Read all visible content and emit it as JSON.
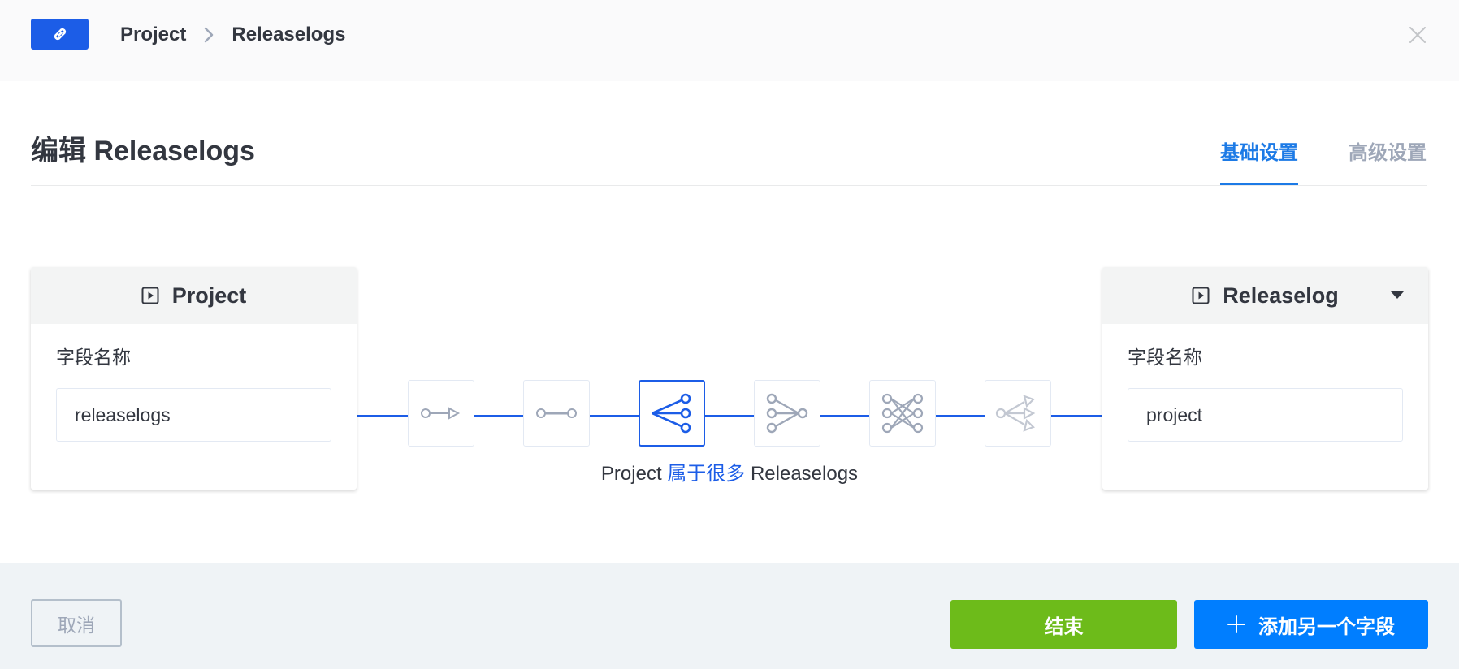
{
  "header": {
    "badge_icon": "link-icon",
    "breadcrumb": [
      "Project",
      "Releaselogs"
    ],
    "close_icon": "close-icon"
  },
  "page": {
    "title": "编辑 Releaselogs",
    "tabs": [
      {
        "label": "基础设置",
        "active": true
      },
      {
        "label": "高级设置",
        "active": false
      }
    ]
  },
  "left_model": {
    "name": "Project",
    "icon": "play-square-icon",
    "field_label": "字段名称",
    "field_value": "releaselogs"
  },
  "right_model": {
    "name": "Releaselog",
    "icon": "play-square-icon",
    "dropdown_icon": "caret-down-icon",
    "field_label": "字段名称",
    "field_value": "project"
  },
  "relation": {
    "types": [
      "one-way",
      "one-to-one",
      "one-to-many",
      "many-to-one",
      "many-to-many",
      "many-way"
    ],
    "selected": "one-to-many",
    "caption_left": "Project",
    "caption_relation": "属于很多",
    "caption_right": "Releaselogs"
  },
  "footer": {
    "cancel_label": "取消",
    "finish_label": "结束",
    "add_label": "添加另一个字段"
  },
  "colors": {
    "primary": "#1c5de7",
    "accent_tab": "#1c7ae6",
    "finish": "#6dbb1a",
    "add": "#007eff",
    "icon_gray": "#9ea7b8"
  }
}
